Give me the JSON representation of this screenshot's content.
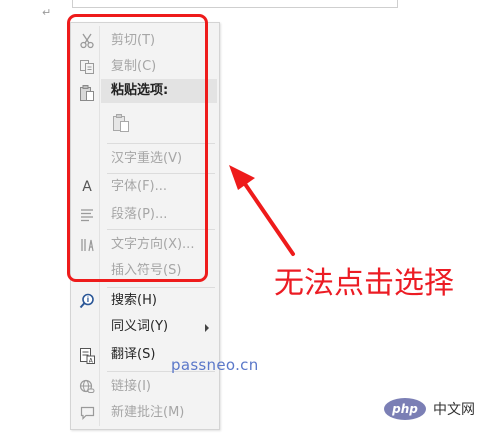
{
  "document": {
    "paragraph_mark": "↵"
  },
  "context_menu": {
    "items": [
      {
        "label": "剪切(T)",
        "icon": "scissors-icon",
        "disabled": true
      },
      {
        "label": "复制(C)",
        "icon": "copy-icon",
        "disabled": true
      },
      {
        "label": "粘贴选项:",
        "icon": "clipboard-icon",
        "disabled": false,
        "header": true
      },
      {
        "label": "",
        "icon": "paste-option-icon",
        "disabled": true
      },
      {
        "label": "汉字重选(V)",
        "icon": "",
        "disabled": true
      },
      {
        "label": "字体(F)...",
        "icon": "font-icon",
        "disabled": true
      },
      {
        "label": "段落(P)...",
        "icon": "paragraph-icon",
        "disabled": true
      },
      {
        "label": "文字方向(X)...",
        "icon": "text-direction-icon",
        "disabled": true
      },
      {
        "label": "插入符号(S)",
        "icon": "",
        "disabled": true
      },
      {
        "label": "搜索(H)",
        "icon": "search-icon",
        "disabled": false
      },
      {
        "label": "同义词(Y)",
        "icon": "",
        "disabled": false,
        "submenu": true
      },
      {
        "label": "翻译(S)",
        "icon": "translate-icon",
        "disabled": false
      },
      {
        "label": "链接(I)",
        "icon": "link-icon",
        "disabled": true
      },
      {
        "label": "新建批注(M)",
        "icon": "comment-icon",
        "disabled": true
      }
    ]
  },
  "annotation": {
    "text": "无法点击选择",
    "color": "#ec1c24"
  },
  "watermark": {
    "text": "passneo.cn"
  },
  "logo": {
    "badge": "php",
    "text": "中文网"
  },
  "colors": {
    "menu_bg": "#f3f3f3",
    "disabled_text": "#a6a6a6",
    "highlight_border": "#ee1b1b"
  }
}
